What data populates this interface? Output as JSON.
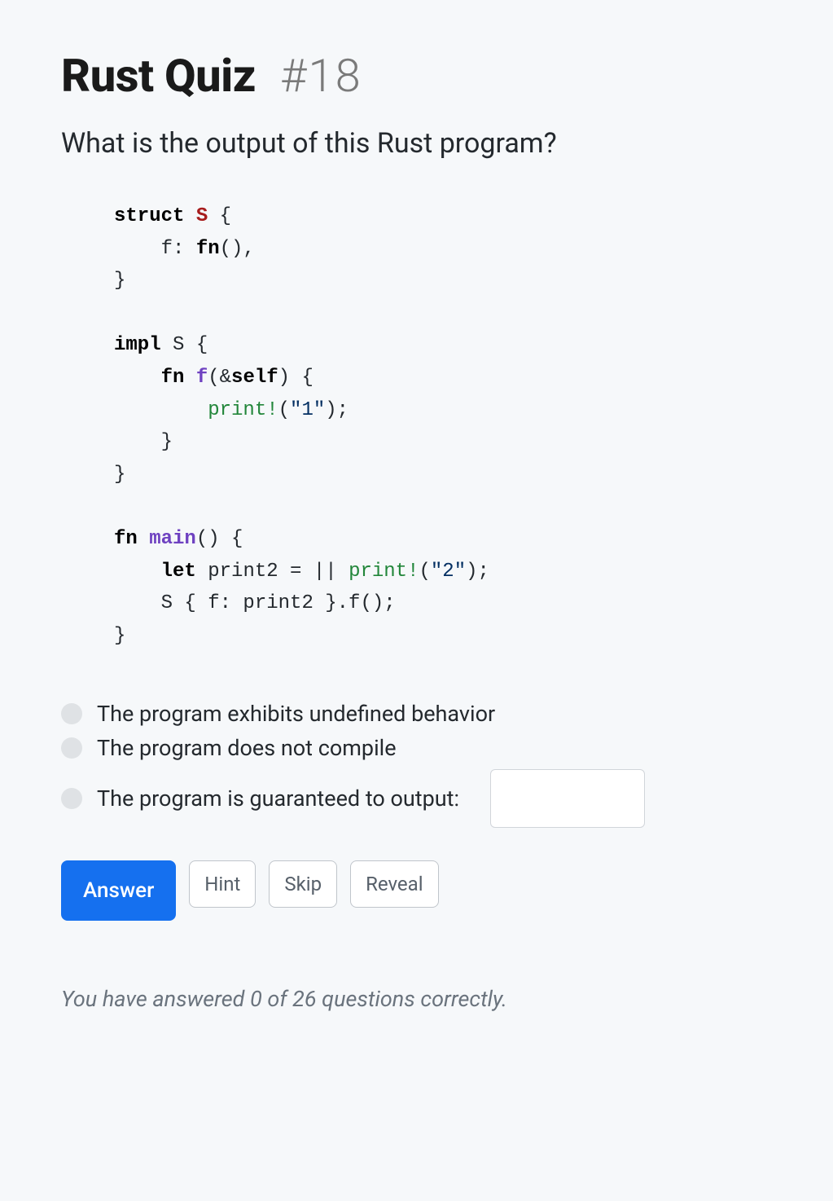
{
  "header": {
    "title": "Rust Quiz",
    "number": "#18"
  },
  "question": "What is the output of this Rust program?",
  "code_tokens": [
    {
      "t": "kw",
      "v": "struct"
    },
    {
      "t": "plain",
      "v": " "
    },
    {
      "t": "ty",
      "v": "S"
    },
    {
      "t": "plain",
      "v": " {"
    },
    {
      "t": "nl"
    },
    {
      "t": "plain",
      "v": "    f: "
    },
    {
      "t": "kw",
      "v": "fn"
    },
    {
      "t": "plain",
      "v": "(),"
    },
    {
      "t": "nl"
    },
    {
      "t": "plain",
      "v": "}"
    },
    {
      "t": "nl"
    },
    {
      "t": "nl"
    },
    {
      "t": "kw",
      "v": "impl"
    },
    {
      "t": "plain",
      "v": " S {"
    },
    {
      "t": "nl"
    },
    {
      "t": "plain",
      "v": "    "
    },
    {
      "t": "kw",
      "v": "fn"
    },
    {
      "t": "plain",
      "v": " "
    },
    {
      "t": "fn-name",
      "v": "f"
    },
    {
      "t": "plain",
      "v": "(&"
    },
    {
      "t": "self-kw",
      "v": "self"
    },
    {
      "t": "plain",
      "v": ") {"
    },
    {
      "t": "nl"
    },
    {
      "t": "plain",
      "v": "        "
    },
    {
      "t": "macro",
      "v": "print!"
    },
    {
      "t": "plain",
      "v": "("
    },
    {
      "t": "str",
      "v": "\"1\""
    },
    {
      "t": "plain",
      "v": ");"
    },
    {
      "t": "nl"
    },
    {
      "t": "plain",
      "v": "    }"
    },
    {
      "t": "nl"
    },
    {
      "t": "plain",
      "v": "}"
    },
    {
      "t": "nl"
    },
    {
      "t": "nl"
    },
    {
      "t": "kw",
      "v": "fn"
    },
    {
      "t": "plain",
      "v": " "
    },
    {
      "t": "fn-name",
      "v": "main"
    },
    {
      "t": "plain",
      "v": "() {"
    },
    {
      "t": "nl"
    },
    {
      "t": "plain",
      "v": "    "
    },
    {
      "t": "kw",
      "v": "let"
    },
    {
      "t": "plain",
      "v": " print2 = || "
    },
    {
      "t": "macro",
      "v": "print!"
    },
    {
      "t": "plain",
      "v": "("
    },
    {
      "t": "str",
      "v": "\"2\""
    },
    {
      "t": "plain",
      "v": ");"
    },
    {
      "t": "nl"
    },
    {
      "t": "plain",
      "v": "    S { f: print2 }.f();"
    },
    {
      "t": "nl"
    },
    {
      "t": "plain",
      "v": "}"
    }
  ],
  "options": [
    {
      "label": "The program exhibits undefined behavior",
      "has_input": false
    },
    {
      "label": "The program does not compile",
      "has_input": false
    },
    {
      "label": "The program is guaranteed to output:",
      "has_input": true
    }
  ],
  "output_value": "",
  "buttons": {
    "answer": "Answer",
    "hint": "Hint",
    "skip": "Skip",
    "reveal": "Reveal"
  },
  "score": {
    "prefix": "You have answered ",
    "correct": 0,
    "mid": " of ",
    "total": 26,
    "suffix": " questions correctly."
  }
}
